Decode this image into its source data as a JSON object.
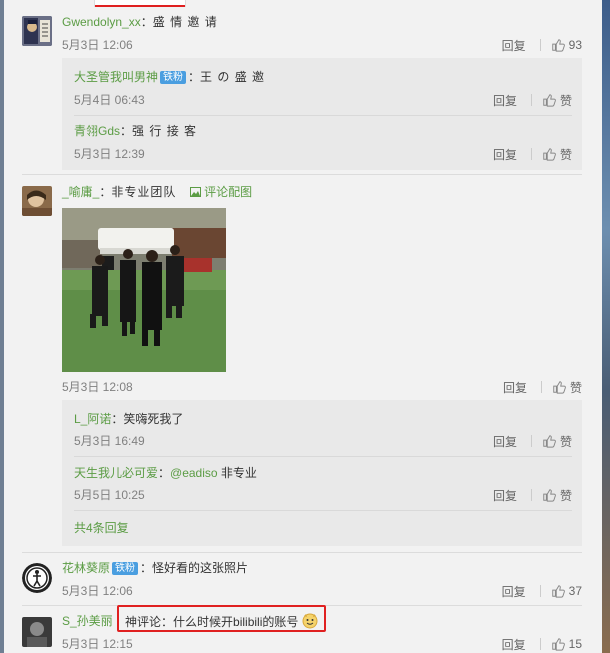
{
  "top_tab": "",
  "comments": [
    {
      "user": "Gwendolyn_xx",
      "text": "盛 情 邀 请",
      "date": "5月3日 12:06",
      "reply_label": "回复",
      "likes": "93",
      "replies": [
        {
          "user": "大圣管我叫男神",
          "badge": "铁粉",
          "text": "王 の 盛 邀",
          "date": "5月4日 06:43",
          "reply_label": "回复",
          "likes": "赞"
        },
        {
          "user": "青翎Gds",
          "text": "强 行 接 客",
          "date": "5月3日 12:39",
          "reply_label": "回复",
          "likes": "赞"
        }
      ]
    },
    {
      "user": "_喻庸_",
      "text": "非专业团队",
      "image_link": "评论配图",
      "date": "5月3日 12:08",
      "reply_label": "回复",
      "likes": "赞",
      "replies": [
        {
          "user": "L_阿诺",
          "text": "笑嗨死我了",
          "date": "5月3日 16:49",
          "reply_label": "回复",
          "likes": "赞"
        },
        {
          "user": "天生我儿必可爱",
          "mention": "@eadiso",
          "text": "非专业",
          "date": "5月5日 10:25",
          "reply_label": "回复",
          "likes": "赞"
        }
      ],
      "more_replies": "共4条回复"
    },
    {
      "user": "花林葵原",
      "badge": "铁粉",
      "text": "怪好看的这张照片",
      "date": "5月3日 12:06",
      "reply_label": "回复",
      "likes": "37"
    },
    {
      "user": "S_孙美丽",
      "text_prefix": "神评论：",
      "text": "什么时候开bilibili的账号",
      "date": "5月3日 12:15",
      "reply_label": "回复",
      "likes": "15"
    }
  ],
  "colors": {
    "username": "#5b9c44",
    "highlight": "#e02020",
    "badge": "#4a9ee0",
    "muted": "#808080"
  },
  "icons": [
    "thumbs-up-icon",
    "image-icon",
    "emoji-icon"
  ]
}
